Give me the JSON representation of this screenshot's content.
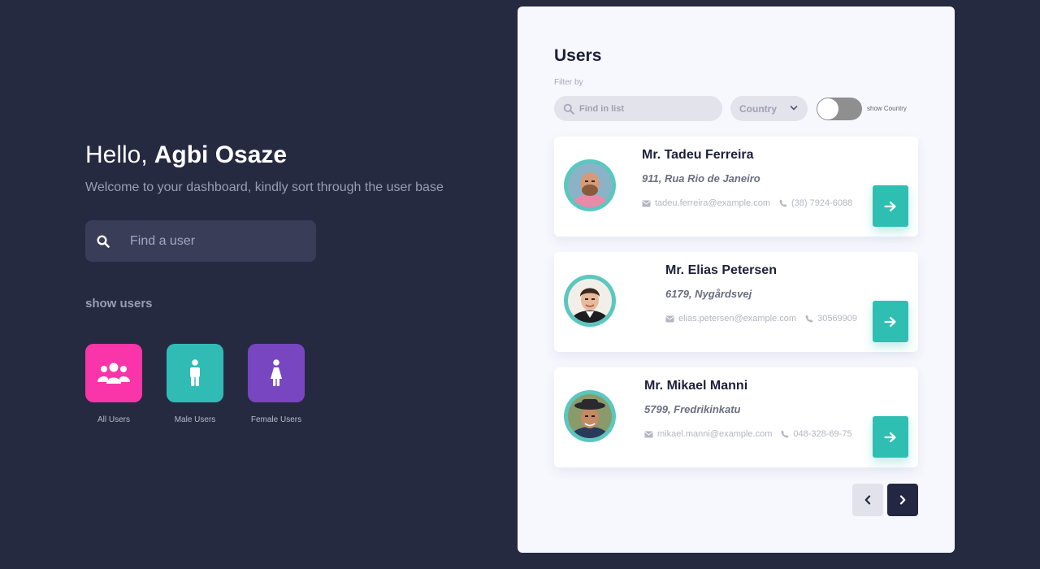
{
  "greeting": {
    "hello": "Hello,",
    "name": "Agbi Osaze"
  },
  "welcome": "Welcome to your dashboard, kindly sort through the user base",
  "search": {
    "placeholder": "Find a user"
  },
  "show_users": "show users",
  "categories": [
    {
      "label": "All Users",
      "icon": "users-group-icon",
      "color": "#f935a9"
    },
    {
      "label": "Male Users",
      "icon": "male-icon",
      "color": "#30bbb5"
    },
    {
      "label": "Female Users",
      "icon": "female-icon",
      "color": "#7946c1"
    }
  ],
  "panel": {
    "title": "Users",
    "filter_label": "Filter by",
    "find_placeholder": "Find in list",
    "country_label": "Country",
    "toggle_label": "show Country",
    "toggle_on": false
  },
  "users": [
    {
      "name": "Mr. Tadeu Ferreira",
      "address": "911, Rua Rio de Janeiro",
      "email": "tadeu.ferreira@example.com",
      "phone": "(38) 7924-6088"
    },
    {
      "name": "Mr. Elias Petersen",
      "address": "6179, Nygårdsvej",
      "email": "elias.petersen@example.com",
      "phone": "30569909"
    },
    {
      "name": "Mr. Mikael Manni",
      "address": "5799, Fredrikinkatu",
      "email": "mikael.manni@example.com",
      "phone": "048-328-69-75"
    }
  ],
  "colors": {
    "background": "#262a41",
    "panel": "#f7f8fe",
    "accent": "#2ebfb2",
    "avatar_ring": "#5bc7bf"
  }
}
